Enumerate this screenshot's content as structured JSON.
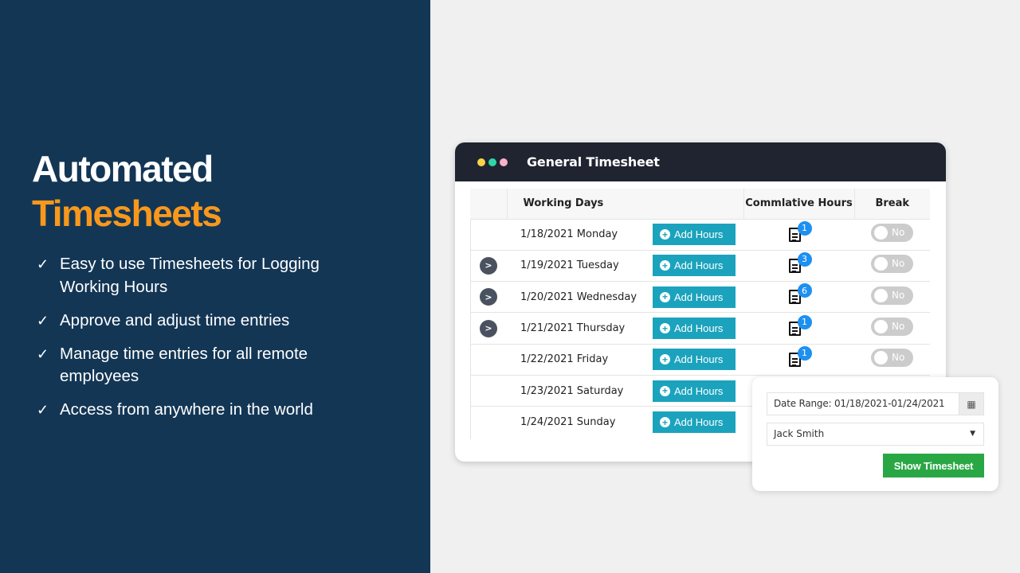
{
  "hero": {
    "title_line1": "Automated",
    "title_line2": "Timesheets",
    "title_line2_color": "#f7981d",
    "bullets": [
      "Easy to use Timesheets for Logging Working Hours",
      "Approve and adjust time entries",
      "Manage time entries for all remote employees",
      "Access from anywhere in the world"
    ],
    "check_icon": "✓"
  },
  "timesheet": {
    "title": "General Timesheet",
    "window_dots": [
      "#f8d347",
      "#2fd6a6",
      "#f7b3c9"
    ],
    "columns": {
      "working_days": "Working Days",
      "cumulative_hours": "Commlative Hours",
      "break": "Break"
    },
    "add_hours_label": "Add Hours",
    "rows": [
      {
        "day": "1/18/2021 Monday",
        "expandable": false,
        "hours_count": "1",
        "break": "No"
      },
      {
        "day": "1/19/2021 Tuesday",
        "expandable": true,
        "hours_count": "3",
        "break": "No"
      },
      {
        "day": "1/20/2021 Wednesday",
        "expandable": true,
        "hours_count": "6",
        "break": "No"
      },
      {
        "day": "1/21/2021 Thursday",
        "expandable": true,
        "hours_count": "1",
        "break": "No"
      },
      {
        "day": "1/22/2021 Friday",
        "expandable": false,
        "hours_count": "1",
        "break": "No"
      },
      {
        "day": "1/23/2021 Saturday",
        "expandable": false,
        "hours_count": null,
        "break": null
      },
      {
        "day": "1/24/2021 Sunday",
        "expandable": false,
        "hours_count": null,
        "break": null
      }
    ]
  },
  "filter": {
    "date_range": "Date Range: 01/18/2021-01/24/2021",
    "employee": "Jack Smith",
    "show_button": "Show Timesheet"
  },
  "colors": {
    "left_panel": "#133655",
    "add_button": "#1ba3bd",
    "badge": "#1e90f0",
    "show_button": "#2aa745"
  }
}
